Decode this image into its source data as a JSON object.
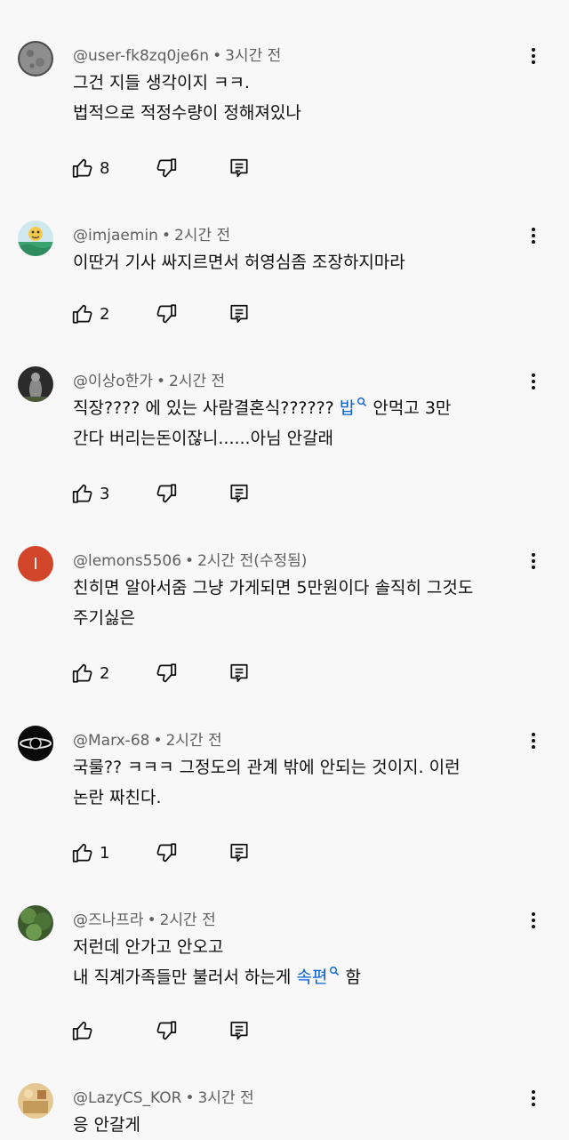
{
  "comments": [
    {
      "author": "@user-fk8zq0je6n",
      "time": "3시간 전",
      "lines": [
        "그건 지들 생각이지 ㅋㅋ.",
        "법적으로 적정수량이 정해져있나"
      ],
      "likes": "8"
    },
    {
      "author": "@imjaemin",
      "time": "2시간 전",
      "lines": [
        "이딴거 기사 싸지르면서 허영심좀 조장하지마라"
      ],
      "likes": "2"
    },
    {
      "author": "@이상o한가",
      "time": "2시간 전",
      "line1_a": "직장????  에 있는 사람결혼식??????",
      "line1_link": "밥",
      "line1_b": "안먹고 3만",
      "line2": "간다 버리는돈이잖니......아님 안갈래",
      "likes": "3"
    },
    {
      "author": "@lemons5506",
      "time": "2시간 전(수정됨)",
      "avatar_letter": "I",
      "lines": [
        "친히면 알아서줌 그냥 가게되면 5만원이다 솔직히 그것도",
        "주기싫은"
      ],
      "likes": "2"
    },
    {
      "author": "@Marx-68",
      "time": "2시간 전",
      "lines": [
        "국룰?? ㅋㅋㅋ 그정도의 관계 밖에 안되는 것이지. 이런",
        "논란 짜친다."
      ],
      "likes": "1"
    },
    {
      "author": "@즈나프라",
      "time": "2시간 전",
      "line1": "저런데 안가고 안오고",
      "line2_a": "내 직계가족들만 불러서 하는게",
      "line2_link": "속편",
      "line2_b": "함",
      "likes": ""
    },
    {
      "author": "@LazyCS_KOR",
      "time": "3시간 전",
      "lines": [
        "응 안갈게"
      ],
      "likes": ""
    }
  ],
  "colors": {
    "link": "#065fd4",
    "meta": "#606060",
    "lemons_avatar": "#d1452b"
  },
  "icons": [
    "thumbs-up-icon",
    "thumbs-down-icon",
    "reply-icon",
    "more-vertical-icon",
    "search-icon"
  ]
}
